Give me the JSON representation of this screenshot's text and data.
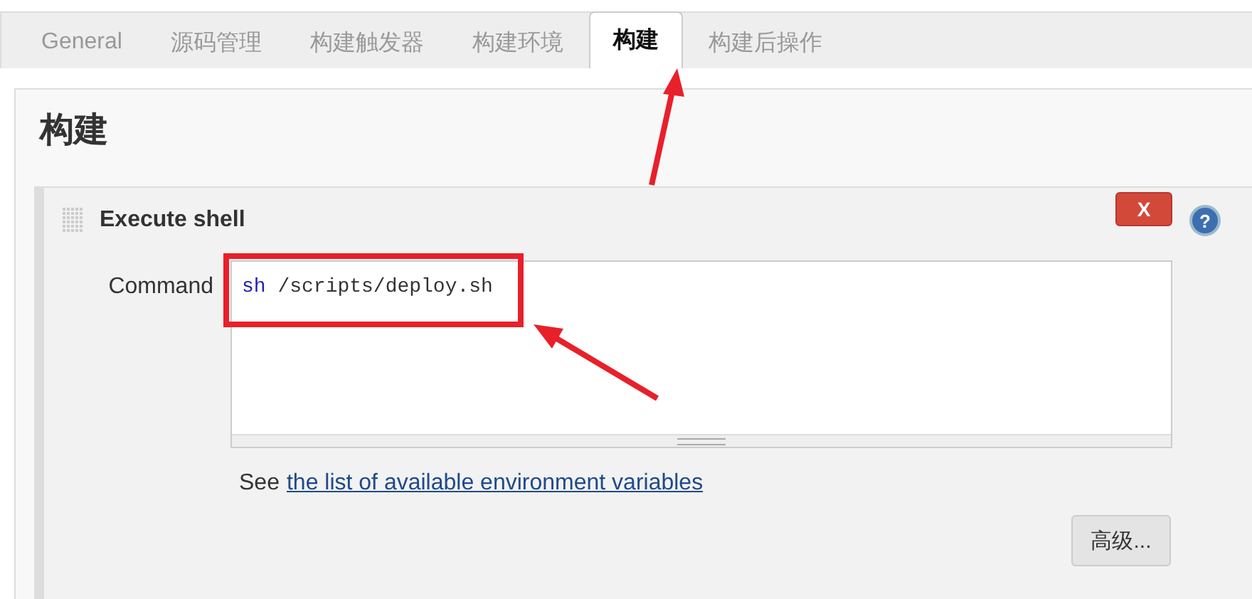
{
  "tabs": [
    {
      "label": "General",
      "selected": false
    },
    {
      "label": "源码管理",
      "selected": false
    },
    {
      "label": "构建触发器",
      "selected": false
    },
    {
      "label": "构建环境",
      "selected": false
    },
    {
      "label": "构建",
      "selected": true
    },
    {
      "label": "构建后操作",
      "selected": false
    }
  ],
  "section": {
    "title": "构建"
  },
  "build_step": {
    "title": "Execute shell",
    "delete_button": "X",
    "help_icon": "?",
    "command_label": "Command",
    "command": {
      "keyword": "sh",
      "rest": " /scripts/deploy.sh"
    },
    "see_text": "See",
    "link": "the list of available environment variables",
    "advanced_button": "高级..."
  }
}
